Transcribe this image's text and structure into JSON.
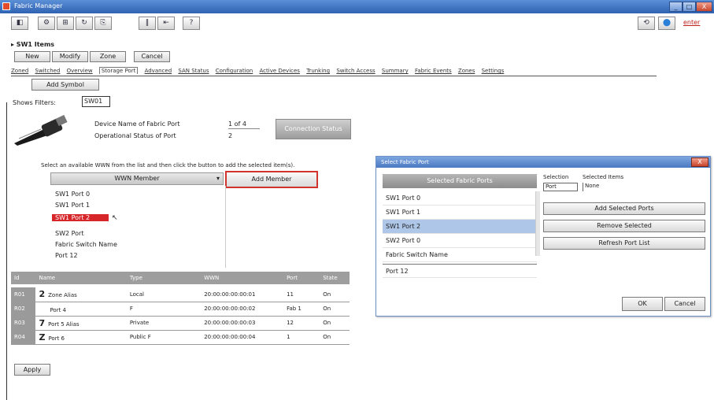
{
  "window": {
    "title": "Fabric Manager",
    "min": "_",
    "max": "□",
    "close": "X"
  },
  "toolbar": {
    "buttons": [
      "◧",
      "⚙",
      "⊞",
      "↻",
      "⎘",
      "‖",
      "⇤",
      "?"
    ],
    "right_buttons": [
      "⟲",
      "⬤"
    ],
    "right_link": "enter"
  },
  "breadcrumb": "▸ SW1 Items",
  "actions": [
    "New",
    "Modify",
    "Zone",
    "Cancel"
  ],
  "tabs": [
    "Zoned",
    "Switched",
    "Overview",
    "Storage Port",
    "Advanced",
    "SAN Status",
    "Configuration",
    "Active Devices",
    "Trunking",
    "Switch Access",
    "Summary",
    "Fabric Events",
    "Zones",
    "Settings"
  ],
  "group_button": "Add Symbol",
  "filter": {
    "label": "Shows Filters:",
    "value": "SW01"
  },
  "device": {
    "line1_label": "Device Name of Fabric Port",
    "line1_value": "1 of 4",
    "line2_label": "Operational Status of Port",
    "line2_value": "2",
    "action_button": "Connection Status"
  },
  "prompt": "Select an available WWN from the list and then click the button to add the selected item(s).",
  "dropdown": {
    "value": "WWN Member",
    "arrow": "▾"
  },
  "add_button": "Add Member",
  "members": [
    "SW1 Port 0",
    "SW1 Port 1",
    "SW1 Port 2",
    "SW2 Port",
    "Fabric Switch Name",
    "Port 12"
  ],
  "members_selected_index": 2,
  "table": {
    "headers": [
      "Id",
      "Name",
      "Type",
      "WWN",
      "Port",
      "State"
    ],
    "rows": [
      [
        "R01",
        "Zone Alias",
        "Local",
        "20:00:00:00:00:01",
        "11",
        "On"
      ],
      [
        "R02",
        "Port 4",
        "F",
        "20:00:00:00:00:02",
        "Fab 1",
        "On"
      ],
      [
        "R03",
        "Port 5 Alias",
        "Private",
        "20:00:00:00:00:03",
        "12",
        "On"
      ],
      [
        "R04",
        "Port 6",
        "Public F",
        "20:00:00:00:00:04",
        "1",
        "On"
      ]
    ],
    "row_icons": [
      "2",
      "",
      "7",
      "Z"
    ]
  },
  "bottom_button": "Apply",
  "dialog": {
    "title": "Select Fabric Port",
    "close": "X",
    "list_header": "Selected Fabric Ports",
    "list": [
      "SW1 Port 0",
      "SW1 Port 1",
      "SW1 Port 2",
      "SW2 Port 0",
      "Fabric Switch Name",
      "Port 12"
    ],
    "list_selected_index": 2,
    "col1_label": "Selection",
    "col1_value": "Port",
    "col2_label": "Selected Items",
    "col2_value": "None",
    "buttons": [
      "Add Selected Ports",
      "Remove Selected",
      "Refresh Port List"
    ],
    "ok": "OK",
    "cancel": "Cancel"
  }
}
